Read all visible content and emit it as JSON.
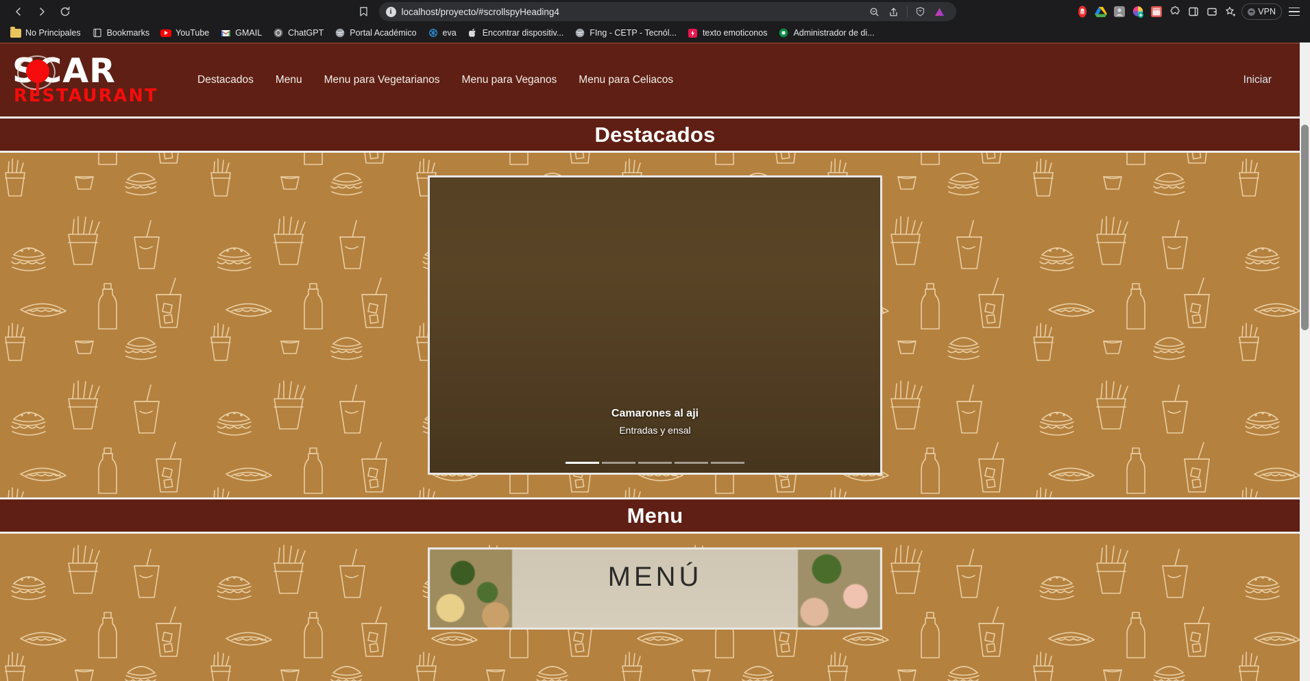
{
  "browser": {
    "url": "localhost/proyecto/#scrollspyHeading4",
    "nav": {
      "back": "back-button",
      "forward": "forward-button",
      "reload": "reload-button"
    },
    "omnibox_icons": [
      "zoom-out-icon",
      "share-icon",
      "brave-shields-icon",
      "brave-leo-icon"
    ],
    "bookmark_icon": "bookmark-icon",
    "vpn_label": "VPN",
    "extensions": [
      "brave-rewards-icon",
      "google-drive-icon",
      "greyed-extension-icon",
      "color-picker-icon",
      "chrome-store-icon",
      "puzzle-extension-icon",
      "sidebar-icon",
      "wallet-icon",
      "favorites-icon"
    ],
    "menu_icon": "hamburger-menu-icon"
  },
  "bookmarks": [
    {
      "label": "No Principales",
      "icon": "folder-icon"
    },
    {
      "label": "Bookmarks",
      "icon": "book-icon"
    },
    {
      "label": "YouTube",
      "icon": "youtube-icon"
    },
    {
      "label": "GMAIL",
      "icon": "gmail-icon"
    },
    {
      "label": "ChatGPT",
      "icon": "chatgpt-icon"
    },
    {
      "label": "Portal Académico",
      "icon": "globe-icon"
    },
    {
      "label": "eva",
      "icon": "eva-icon"
    },
    {
      "label": "Encontrar dispositiv...",
      "icon": "apple-icon"
    },
    {
      "label": "FIng - CETP - Tecnól...",
      "icon": "globe-icon"
    },
    {
      "label": "texto emoticonos",
      "icon": "lightning-icon"
    },
    {
      "label": "Administrador de di...",
      "icon": "device-manager-icon"
    }
  ],
  "site": {
    "brand": {
      "line1": "SCAR",
      "line2": "RESTAURANT",
      "colors": {
        "white": "#ffffff",
        "red": "#f60c0c",
        "navbar": "#5f1f14"
      }
    },
    "nav_links": [
      "Destacados",
      "Menu",
      "Menu para Vegetarianos",
      "Menu para Veganos",
      "Menu para Celiacos"
    ],
    "login_label": "Iniciar",
    "sections": [
      {
        "id": "destacados",
        "heading": "Destacados"
      },
      {
        "id": "menu",
        "heading": "Menu"
      }
    ],
    "carousel": {
      "slide_title": "Camarones al aji",
      "slide_subtitle": "Entradas y ensal",
      "indicator_count": 5,
      "active_index": 0
    },
    "menu_image": {
      "word": "MENÚ"
    }
  }
}
